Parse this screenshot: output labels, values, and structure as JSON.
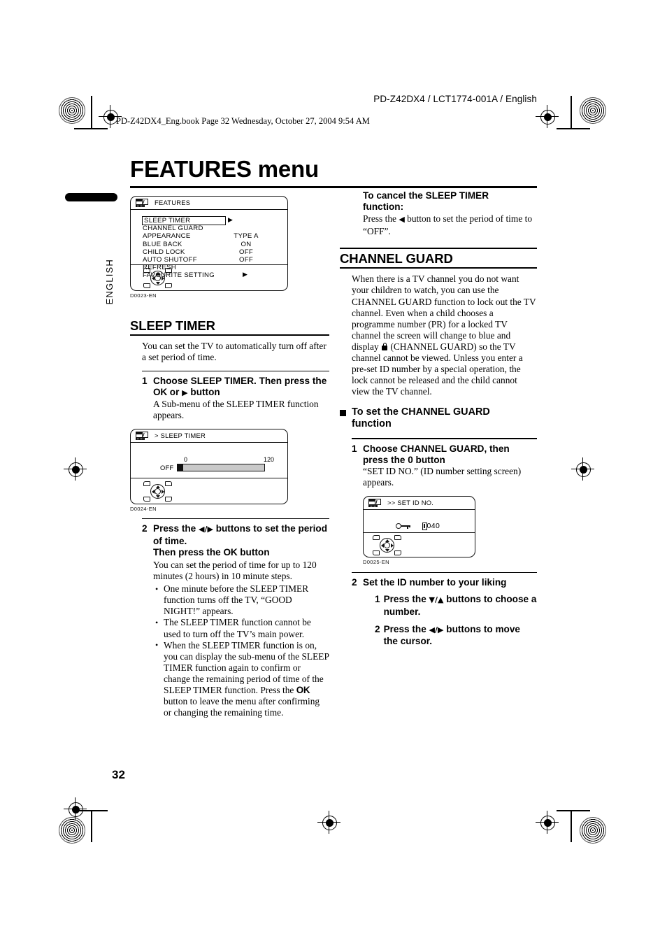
{
  "header": {
    "model_line": "PD-Z42DX4 / LCT1774-001A / English",
    "book_line": "PD-Z42DX4_Eng.book  Page 32  Wednesday, October 27, 2004  9:54 AM"
  },
  "page_title": "FEATURES menu",
  "language_tab": "ENGLISH",
  "page_number": "32",
  "figures": {
    "features_menu": {
      "title": "FEATURES",
      "caption": "D0023-EN",
      "rows": [
        {
          "label": "SLEEP TIMER",
          "value": "",
          "arrow": "▶",
          "selected": true
        },
        {
          "label": "CHANNEL GUARD",
          "value": "",
          "arrow": "",
          "selected": false
        },
        {
          "label": "APPEARANCE",
          "value": "TYPE A",
          "arrow": "",
          "selected": false
        },
        {
          "label": "BLUE BACK",
          "value": "ON",
          "arrow": "",
          "selected": false
        },
        {
          "label": "CHILD LOCK",
          "value": "OFF",
          "arrow": "",
          "selected": false
        },
        {
          "label": "AUTO SHUTOFF",
          "value": "OFF",
          "arrow": "",
          "selected": false
        },
        {
          "label": "REFRESH",
          "value": "",
          "arrow": "",
          "selected": false
        },
        {
          "label": "FAVOURITE SETTING",
          "value": "",
          "arrow": "▶",
          "selected": false
        }
      ]
    },
    "sleep_timer_submenu": {
      "title": "> SLEEP TIMER",
      "caption": "D0024-EN",
      "scale_min": "0",
      "scale_max": "120",
      "current_value": "OFF"
    },
    "set_id_no": {
      "title": ">> SET ID NO.",
      "caption": "D0025-EN",
      "id_value": "040"
    }
  },
  "left_column": {
    "sleep_timer": {
      "heading": "SLEEP TIMER",
      "intro": "You can set the TV to automatically turn off after a set period of time.",
      "step1": {
        "number": "1",
        "title_a": "Choose SLEEP TIMER. Then press the ",
        "title_ok": "OK",
        "title_b": " or ",
        "title_arrow": "▶",
        "title_c": " button",
        "text": "A Sub-menu of the SLEEP TIMER function appears."
      },
      "step2": {
        "number": "2",
        "title_a": "Press the ",
        "title_arrows": "◀/▶",
        "title_b": " buttons to set the period of time.",
        "title_c": "Then press the ",
        "title_ok": "OK",
        "title_d": " button",
        "text": "You can set the period of time for up to 120 minutes (2 hours) in 10 minute steps.",
        "bullets": [
          "One minute before the SLEEP TIMER function turns off the TV, “GOOD NIGHT!” appears.",
          "The SLEEP TIMER function cannot be used to turn off the TV’s main power.",
          "When the SLEEP TIMER function is on, you can display the sub-menu of the SLEEP TIMER function again to confirm or change the remaining period of time of the SLEEP TIMER function. Press the OK button to leave the menu after confirming or changing the remaining time."
        ],
        "bullet3_part1": "When the SLEEP TIMER function is on, you can display the sub-menu of the SLEEP TIMER function again to confirm or change the remaining period of time of the SLEEP TIMER function. Press the ",
        "bullet3_ok": "OK",
        "bullet3_part2": " button to leave the menu after confirming or changing the remaining time."
      }
    }
  },
  "right_column": {
    "cancel_note": {
      "heading_line1": "To cancel the SLEEP TIMER",
      "heading_line2": "function:",
      "text_a": "Press the ",
      "arrow": "◀",
      "text_b": " button to set the period of time to “OFF”."
    },
    "channel_guard": {
      "heading": "CHANNEL GUARD",
      "intro_a": "When there is a TV channel you do not want your children to watch, you can use the CHANNEL GUARD function to lock out the TV channel. Even when a child chooses a programme number (PR) for a locked TV channel the screen will change to blue and display ",
      "intro_lock": "lock-icon",
      "intro_b": " (CHANNEL GUARD) so the TV channel cannot be viewed. Unless you enter a pre-set ID number by a special operation, the lock cannot be released and the child cannot view the TV channel.",
      "subhead_line1": "To set the CHANNEL GUARD",
      "subhead_line2": "function",
      "step1": {
        "number": "1",
        "title_a": "Choose CHANNEL GUARD, then press the ",
        "title_zero": "0",
        "title_b": " button",
        "text": "“SET ID NO.” (ID number setting screen) appears."
      },
      "step2": {
        "number": "2",
        "title": "Set the ID number to your liking",
        "substeps": [
          {
            "number": "1",
            "text_a": "Press the ",
            "arrows": "▼/▲",
            "text_b": " buttons to choose a number."
          },
          {
            "number": "2",
            "text_a": "Press the ",
            "arrows": "◀/▶",
            "text_b": " buttons to move the cursor."
          }
        ]
      }
    }
  }
}
